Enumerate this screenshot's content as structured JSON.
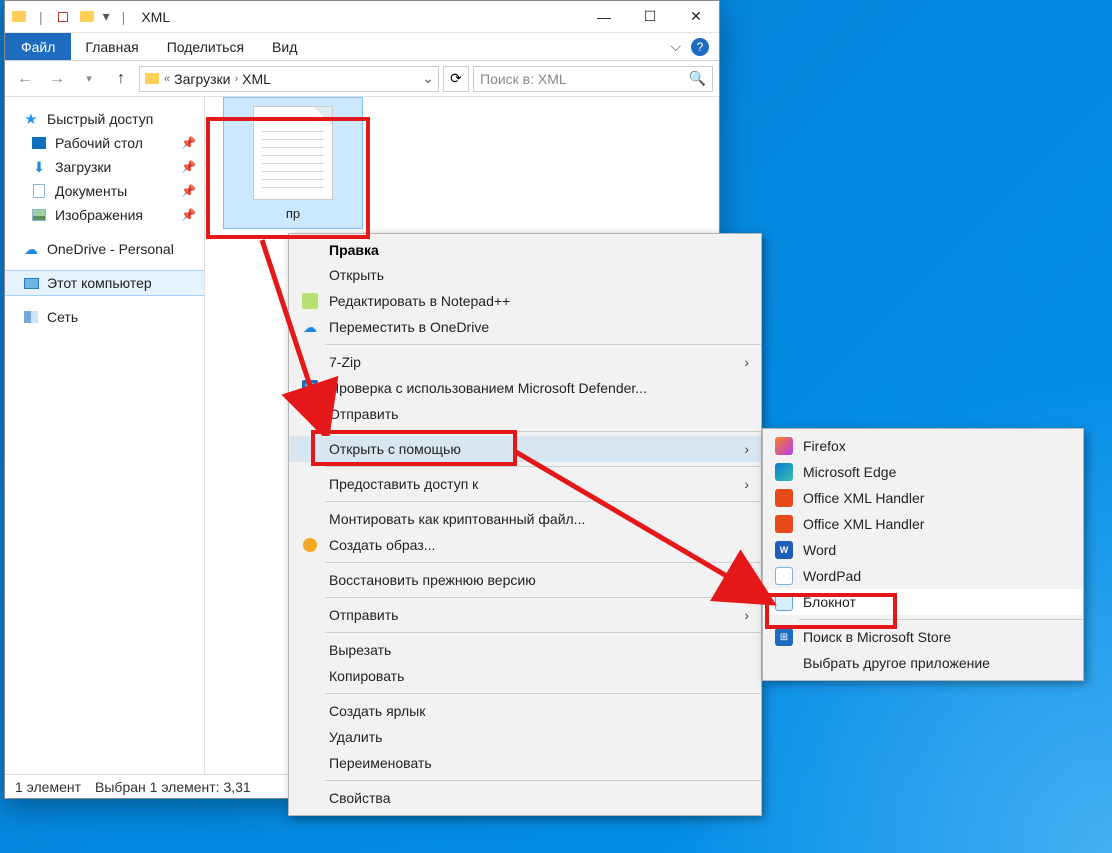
{
  "window": {
    "title": "XML",
    "ribbon": {
      "file": "Файл",
      "tabs": [
        "Главная",
        "Поделиться",
        "Вид"
      ]
    },
    "breadcrumb": {
      "prefix": "«",
      "parts": [
        "Загрузки",
        "XML"
      ]
    },
    "search_placeholder": "Поиск в: XML"
  },
  "sidebar": {
    "quick_access": "Быстрый доступ",
    "items": [
      {
        "label": "Рабочий стол",
        "pin": true
      },
      {
        "label": "Загрузки",
        "pin": true
      },
      {
        "label": "Документы",
        "pin": true
      },
      {
        "label": "Изображения",
        "pin": true
      }
    ],
    "onedrive": "OneDrive - Personal",
    "thispc": "Этот компьютер",
    "network": "Сеть"
  },
  "file": {
    "name": "пр"
  },
  "statusbar": {
    "count": "1 элемент",
    "selected": "Выбран 1 элемент: 3,31"
  },
  "context": {
    "title": "Правка",
    "items": [
      {
        "label": "Открыть",
        "sub": false
      },
      {
        "label": "Редактировать в Notepad++",
        "icon": "npp",
        "sub": false
      },
      {
        "label": "Переместить в OneDrive",
        "icon": "onedrive",
        "sub": false
      },
      {
        "label": "7-Zip",
        "sub": true,
        "sep_before": true
      },
      {
        "label": "Проверка с использованием Microsoft Defender...",
        "icon": "defender",
        "sub": false
      },
      {
        "label": "Отправить",
        "icon": "share",
        "sub": false
      },
      {
        "label": "Открыть с помощью",
        "sub": true,
        "hover": true,
        "sep_before": true
      },
      {
        "label": "Предоставить доступ к",
        "sub": true,
        "sep_before": true
      },
      {
        "label": "Монтировать как криптованный файл...",
        "sub": false,
        "sep_before": true
      },
      {
        "label": "Создать образ...",
        "icon": "disk",
        "sub": false
      },
      {
        "label": "Восстановить прежнюю версию",
        "sub": false,
        "sep_before": true
      },
      {
        "label": "Отправить",
        "sub": true,
        "sep_before": true
      },
      {
        "label": "Вырезать",
        "sub": false,
        "sep_before": true
      },
      {
        "label": "Копировать",
        "sub": false
      },
      {
        "label": "Создать ярлык",
        "sub": false,
        "sep_before": true
      },
      {
        "label": "Удалить",
        "sub": false
      },
      {
        "label": "Переименовать",
        "sub": false
      },
      {
        "label": "Свойства",
        "sub": false,
        "sep_before": true
      }
    ]
  },
  "submenu": {
    "items": [
      {
        "label": "Firefox",
        "icon": "firefox"
      },
      {
        "label": "Microsoft Edge",
        "icon": "edge"
      },
      {
        "label": "Office XML Handler",
        "icon": "office"
      },
      {
        "label": "Office XML Handler",
        "icon": "office"
      },
      {
        "label": "Word",
        "icon": "word"
      },
      {
        "label": "WordPad",
        "icon": "wordpad"
      },
      {
        "label": "Блокнот",
        "icon": "notepad",
        "hover": true
      }
    ],
    "store": "Поиск в Microsoft Store",
    "other": "Выбрать другое приложение"
  }
}
